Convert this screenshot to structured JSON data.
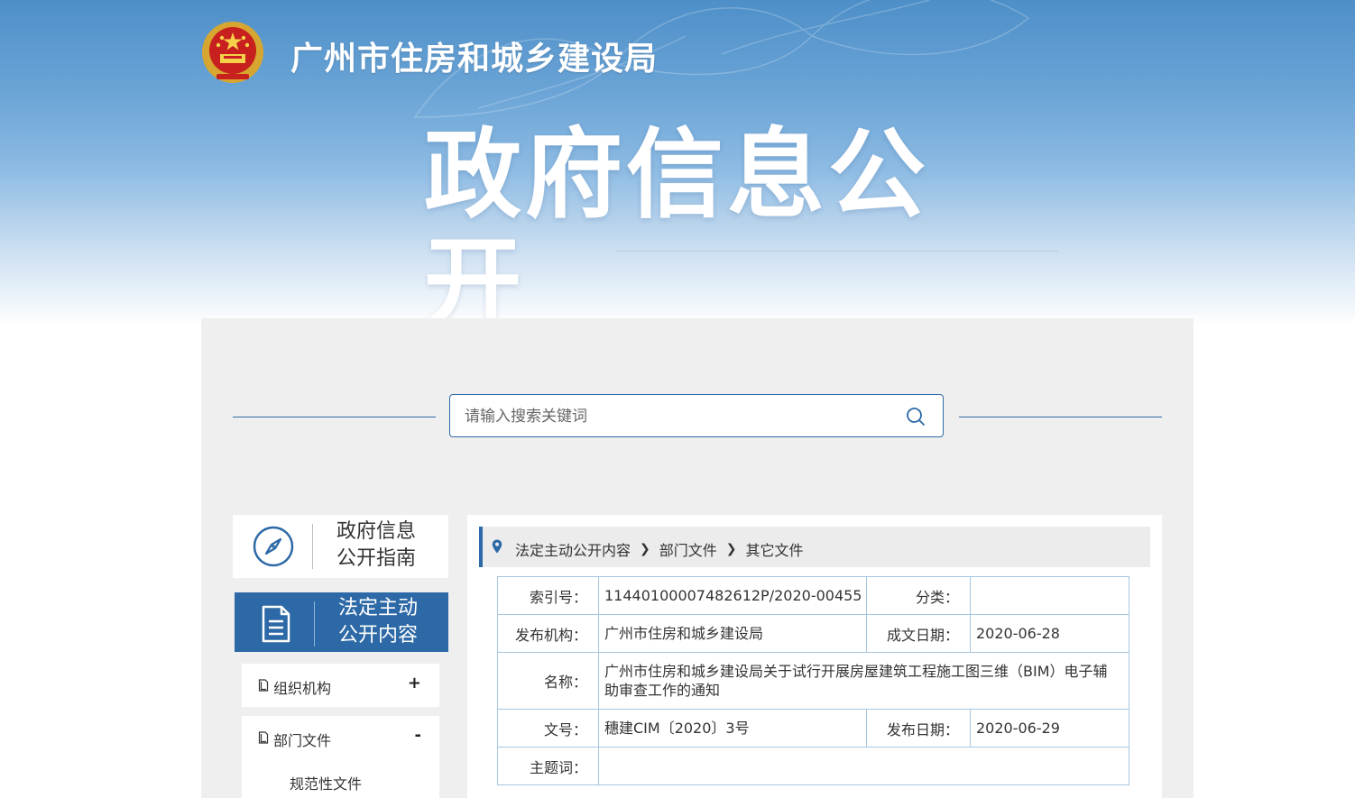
{
  "header": {
    "site_name": "广州市住房和城乡建设局",
    "banner_title": "政府信息公开",
    "emblem_icon": "national-emblem-icon"
  },
  "search": {
    "placeholder": "请输入搜索关键词",
    "value": "",
    "icon": "search-icon"
  },
  "sidebar": {
    "guide": {
      "label_line1": "政府信息",
      "label_line2": "公开指南",
      "icon": "compass-icon"
    },
    "active": {
      "label_line1": "法定主动",
      "label_line2": "公开内容",
      "icon": "document-icon"
    },
    "items": [
      {
        "label": "组织机构",
        "toggle": "+"
      },
      {
        "label": "部门文件",
        "toggle": "-"
      }
    ],
    "subitems": [
      {
        "label": "规范性文件"
      }
    ]
  },
  "breadcrumb": {
    "icon": "location-pin-icon",
    "items": [
      "法定主动公开内容",
      "部门文件",
      "其它文件"
    ]
  },
  "details": {
    "index_label": "索引号：",
    "index_value": "11440100007482612P/2020-00455",
    "category_label": "分类：",
    "category_value": "",
    "publisher_label": "发布机构：",
    "publisher_value": "广州市住房和城乡建设局",
    "created_label": "成文日期：",
    "created_value": "2020-06-28",
    "name_label": "名称：",
    "name_value": "广州市住房和城乡建设局关于试行开展房屋建筑工程施工图三维（BIM）电子辅助审查工作的通知",
    "doc_no_label": "文号：",
    "doc_no_value": "穗建CIM〔2020〕3号",
    "published_label": "发布日期：",
    "published_value": "2020-06-29",
    "subject_label": "主题词：",
    "subject_value": ""
  },
  "colors": {
    "primary": "#2d69a6",
    "border": "#a6c6e0",
    "panel_bg": "#efefef"
  }
}
